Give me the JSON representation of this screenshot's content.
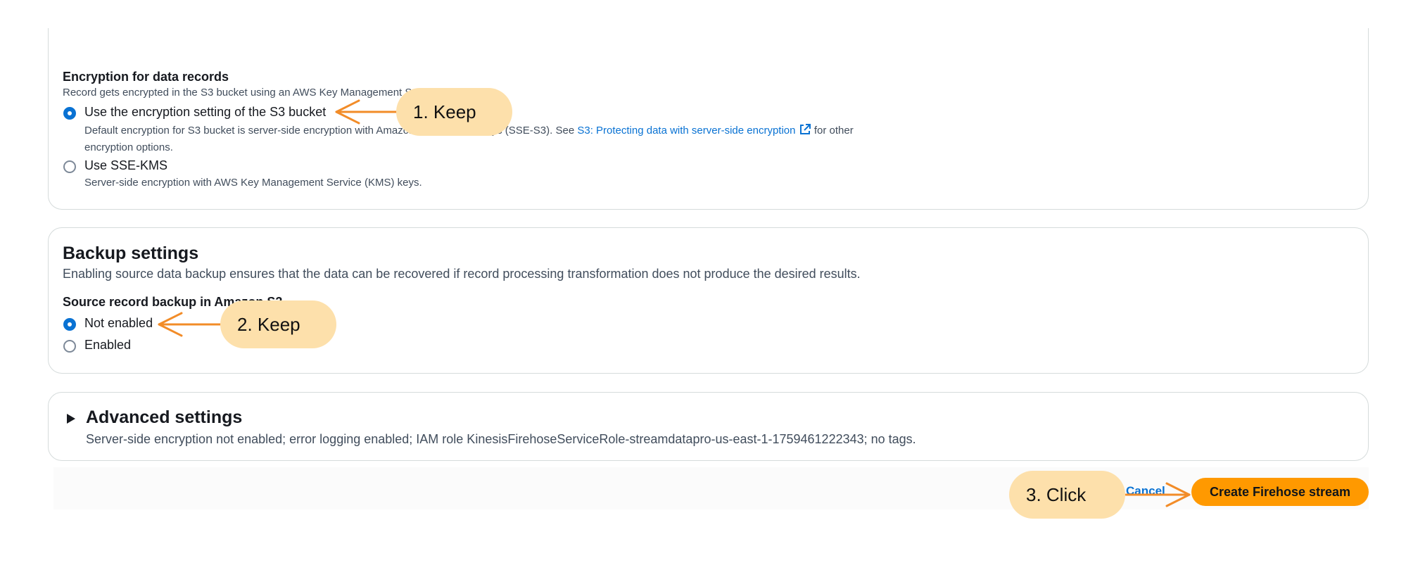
{
  "encryption": {
    "heading": "Encryption for data records",
    "description": "Record gets encrypted in the S3 bucket using an AWS Key Management Service (KMS) key.",
    "option1_label": "Use the encryption setting of the S3 bucket",
    "option1_desc_a": "Default encryption for S3 bucket is server-side encryption with Amazon S3 managed keys (SSE-S3). See ",
    "option1_link": "S3: Protecting data with server-side encryption",
    "option1_desc_b": " for other",
    "option1_desc_c": "encryption options.",
    "option2_label": "Use SSE-KMS",
    "option2_desc": "Server-side encryption with AWS Key Management Service (KMS) keys.",
    "selected": "option1"
  },
  "backup": {
    "title": "Backup settings",
    "description": "Enabling source data backup ensures that the data can be recovered if record processing transformation does not produce the desired results.",
    "field_label": "Source record backup in Amazon S3",
    "option1_label": "Not enabled",
    "option2_label": "Enabled",
    "selected": "option1"
  },
  "advanced": {
    "title": "Advanced settings",
    "summary": "Server-side encryption not enabled; error logging enabled; IAM role KinesisFirehoseServiceRole-streamdatapro-us-east-1-1759461222343; no tags.",
    "toggle_icon": "caret-right-icon"
  },
  "footer": {
    "cancel_label": "Cancel",
    "create_label": "Create Firehose stream"
  },
  "annotations": {
    "step1": "1. Keep",
    "step2": "2. Keep",
    "step3": "3. Click",
    "arrow_color": "#f28c28",
    "callout_color": "#fde0ab"
  },
  "colors": {
    "accent": "#0972d3",
    "primary_button": "#ff9900",
    "border": "#d5dbdb"
  }
}
